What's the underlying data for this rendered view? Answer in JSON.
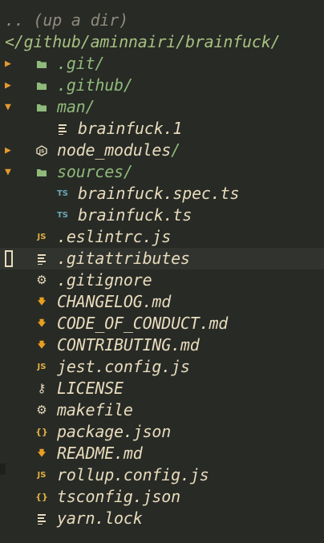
{
  "header": {
    "updir_label": ".. (up a dir)",
    "path": "</github/aminnairi/brainfuck/"
  },
  "tree": [
    {
      "id": "git",
      "name": ".git",
      "slash": "/",
      "type": "dir",
      "level": 1,
      "arrow": "▶",
      "icon": "folder-icon"
    },
    {
      "id": "github",
      "name": ".github",
      "slash": "/",
      "type": "dir",
      "level": 1,
      "arrow": "▶",
      "icon": "folder-icon"
    },
    {
      "id": "man",
      "name": "man",
      "slash": "/",
      "type": "dir",
      "level": 1,
      "arrow": "▼",
      "icon": "folder-icon"
    },
    {
      "id": "brainfuck-1",
      "name": "brainfuck.1",
      "type": "file",
      "level": 2,
      "icon": "text-file-icon"
    },
    {
      "id": "node-modules",
      "name": "node_modules",
      "slash": "/",
      "type": "dir",
      "level": 1,
      "arrow": "▶",
      "icon": "nodejs-icon",
      "name_style": "file"
    },
    {
      "id": "sources",
      "name": "sources",
      "slash": "/",
      "type": "dir",
      "level": 1,
      "arrow": "▼",
      "icon": "folder-icon"
    },
    {
      "id": "brainfuck-spec-ts",
      "name": "brainfuck.spec.ts",
      "type": "file",
      "level": 2,
      "icon": "typescript-icon",
      "icon_text": "TS"
    },
    {
      "id": "brainfuck-ts",
      "name": "brainfuck.ts",
      "type": "file",
      "level": 2,
      "icon": "typescript-icon",
      "icon_text": "TS"
    },
    {
      "id": "eslintrc",
      "name": ".eslintrc.js",
      "type": "file",
      "level": 1,
      "icon": "javascript-icon",
      "icon_text": "JS"
    },
    {
      "id": "gitattributes",
      "name": ".gitattributes",
      "type": "file",
      "level": 1,
      "icon": "text-file-icon",
      "current": true
    },
    {
      "id": "gitignore",
      "name": ".gitignore",
      "type": "file",
      "level": 1,
      "icon": "gear-icon",
      "icon_text": "⚙"
    },
    {
      "id": "changelog",
      "name": "CHANGELOG.md",
      "type": "file",
      "level": 1,
      "icon": "markdown-icon",
      "icon_text": "🡇"
    },
    {
      "id": "code-of-conduct",
      "name": "CODE_OF_CONDUCT.md",
      "type": "file",
      "level": 1,
      "icon": "markdown-icon",
      "icon_text": "🡇"
    },
    {
      "id": "contributing",
      "name": "CONTRIBUTING.md",
      "type": "file",
      "level": 1,
      "icon": "markdown-icon",
      "icon_text": "🡇"
    },
    {
      "id": "jest-config",
      "name": "jest.config.js",
      "type": "file",
      "level": 1,
      "icon": "javascript-icon",
      "icon_text": "JS"
    },
    {
      "id": "license",
      "name": "LICENSE",
      "type": "file",
      "level": 1,
      "icon": "key-icon",
      "icon_text": "⚷"
    },
    {
      "id": "makefile",
      "name": "makefile",
      "type": "file",
      "level": 1,
      "icon": "gear-icon",
      "icon_text": "⚙"
    },
    {
      "id": "package-json",
      "name": "package.json",
      "type": "file",
      "level": 1,
      "icon": "json-icon",
      "icon_text": "{}"
    },
    {
      "id": "readme",
      "name": "README.md",
      "type": "file",
      "level": 1,
      "icon": "markdown-icon",
      "icon_text": "🡇"
    },
    {
      "id": "rollup-config",
      "name": "rollup.config.js",
      "type": "file",
      "level": 1,
      "icon": "javascript-icon",
      "icon_text": "JS"
    },
    {
      "id": "tsconfig",
      "name": "tsconfig.json",
      "type": "file",
      "level": 1,
      "icon": "json-icon",
      "icon_text": "{}"
    },
    {
      "id": "yarn-lock",
      "name": "yarn.lock",
      "type": "file",
      "level": 1,
      "icon": "text-file-icon"
    }
  ],
  "colors": {
    "background": "#282a26",
    "directory": "#8fba7a",
    "file": "#e8dcbc",
    "arrow": "#e69a2e",
    "path": "#a7c080",
    "updir": "#8f8a7c",
    "current_line": "#31332f"
  }
}
